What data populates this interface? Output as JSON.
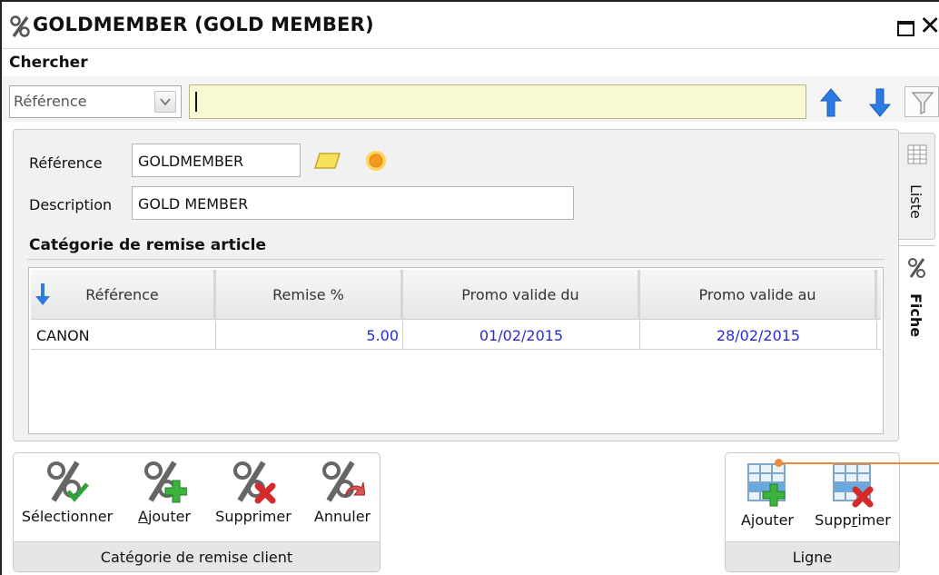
{
  "window": {
    "title": "GOLDMEMBER (GOLD MEMBER)",
    "icon": "percent-icon",
    "maximize_icon": "maximize-icon",
    "close_icon": "close-icon"
  },
  "search": {
    "label": "Chercher",
    "field_selected": "Référence",
    "value": "",
    "up_icon": "arrow-up-icon",
    "down_icon": "arrow-down-icon",
    "filter_icon": "funnel-icon"
  },
  "form": {
    "reference_label": "Référence",
    "reference_value": "GOLDMEMBER",
    "description_label": "Description",
    "description_value": "GOLD MEMBER",
    "note_icon": "note-icon",
    "sun_icon": "sun-icon"
  },
  "section": {
    "title": "Catégorie de remise article"
  },
  "grid": {
    "columns": [
      "Référence",
      "Remise %",
      "Promo valide du",
      "Promo valide au"
    ],
    "sort_icon": "sort-down-icon",
    "rows": [
      {
        "reference": "CANON",
        "remise": "5.00",
        "du": "01/02/2015",
        "au": "28/02/2015"
      }
    ]
  },
  "tabs": {
    "liste": "Liste",
    "fiche": "Fiche"
  },
  "toolbar_client": {
    "footer": "Catégorie de remise client",
    "buttons": [
      {
        "label": "Sélectionner",
        "icon": "percent-check-icon"
      },
      {
        "label": "Ajouter",
        "icon": "percent-add-icon"
      },
      {
        "label": "Supprimer",
        "icon": "percent-delete-icon"
      },
      {
        "label": "Annuler",
        "icon": "percent-undo-icon"
      }
    ]
  },
  "toolbar_ligne": {
    "footer": "Ligne",
    "buttons": [
      {
        "label": "Ajouter",
        "icon": "grid-add-icon"
      },
      {
        "label": "Supprimer",
        "icon": "grid-delete-icon"
      }
    ]
  },
  "colors": {
    "search_bg": "#fafad2",
    "link_blue": "#2b2bd6",
    "arrow_blue": "#2a7be4",
    "callout_orange": "#e98b3a"
  }
}
